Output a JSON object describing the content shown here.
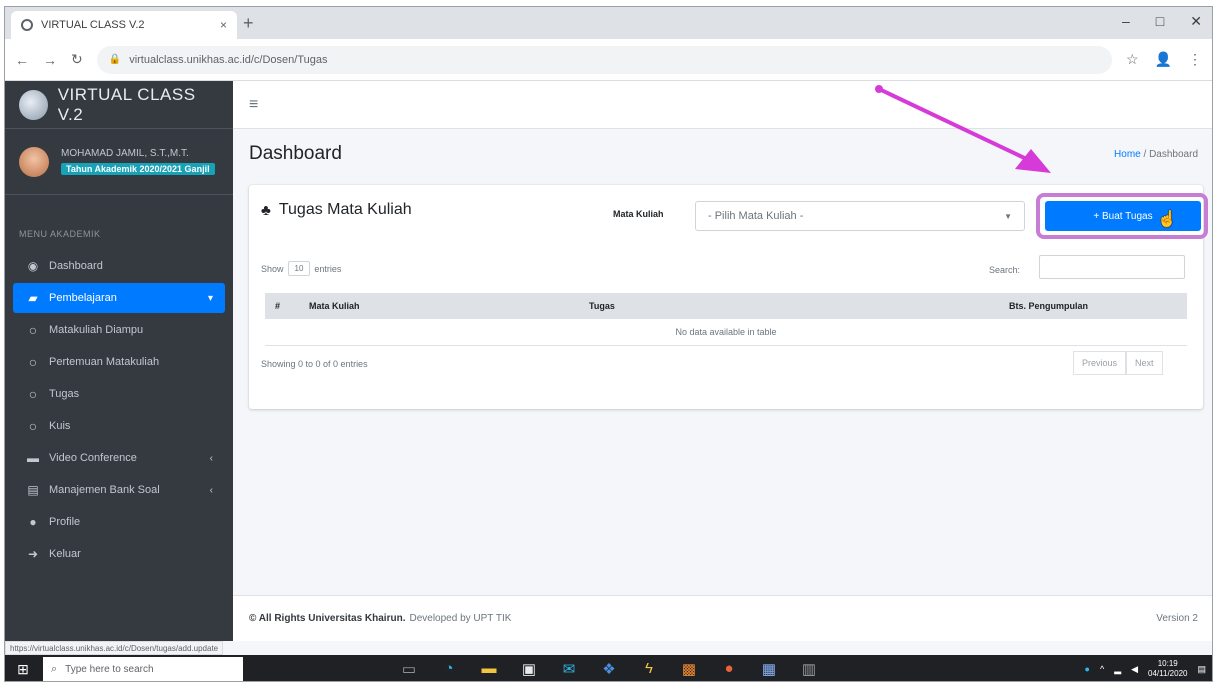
{
  "browser": {
    "tab_title": "VIRTUAL CLASS V.2",
    "tab_close": "×",
    "new_tab": "+",
    "url": "virtualclass.unikhas.ac.id/c/Dosen/Tugas",
    "window_controls": [
      "–",
      "□",
      "✕"
    ]
  },
  "sidebar": {
    "brand": "VIRTUAL CLASS V.2",
    "user_name": "MOHAMAD JAMIL, S.T.,M.T.",
    "user_badge": "Tahun Akademik 2020/2021 Ganjil",
    "menu_header": "MENU AKADEMIK",
    "items": [
      {
        "label": "Dashboard",
        "icon": "dashboard-icon"
      },
      {
        "label": "Pembelajaran",
        "icon": "chalkboard-icon",
        "active": true
      },
      {
        "label": "Matakuliah Diampu",
        "icon": "circle-icon"
      },
      {
        "label": "Pertemuan Matakuliah",
        "icon": "circle-icon"
      },
      {
        "label": "Tugas",
        "icon": "circle-icon"
      },
      {
        "label": "Kuis",
        "icon": "circle-icon"
      },
      {
        "label": "Video Conference",
        "icon": "video-icon"
      },
      {
        "label": "Manajemen Bank Soal",
        "icon": "book-icon"
      },
      {
        "label": "Profile",
        "icon": "user-icon"
      },
      {
        "label": "Keluar",
        "icon": "logout-icon"
      }
    ]
  },
  "topnav": {
    "menu_toggle": "≡"
  },
  "page": {
    "title": "Dashboard",
    "breadcrumb_home": "Home",
    "breadcrumb_sep": "/",
    "breadcrumb_current": "Dashboard"
  },
  "card": {
    "title": "Tugas Mata Kuliah",
    "mata_kuliah_label": "Mata Kuliah",
    "select_value": "- Pilih Mata Kuliah -",
    "add_button": "+ Buat Tugas",
    "show_label": "Show",
    "entries_value": "10",
    "entries_label": "entries",
    "search_label": "Search:",
    "columns": [
      "#",
      "Mata Kuliah",
      "Tugas",
      "Bts. Pengumpulan"
    ],
    "empty_text": "No data available in table",
    "showing_text": "Showing 0 to 0 of 0 entries",
    "prev": "Previous",
    "next": "Next"
  },
  "footer": {
    "copyright": "© All Rights Universitas Khairun.",
    "developed": "Developed by UPT TIK",
    "version": "Version 2"
  },
  "statusbar": "https://virtualclass.unikhas.ac.id/c/Dosen/tugas/add.update",
  "taskbar": {
    "search_placeholder": "Type here to search",
    "time": "10:19",
    "date": "04/11/2020"
  },
  "colors": {
    "sidebar_bg": "#343a40",
    "primary": "#007bff",
    "highlight": "#c77dd4",
    "arrow": "#d63ad8"
  }
}
